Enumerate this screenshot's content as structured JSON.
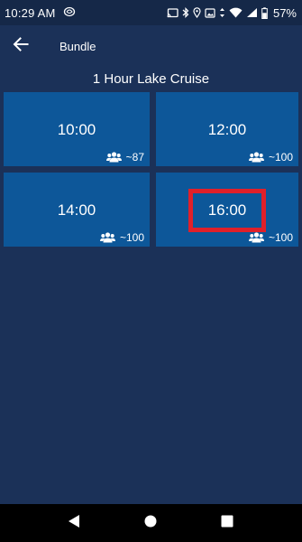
{
  "status_bar": {
    "time": "10:29 AM",
    "battery": "57%",
    "icons": [
      "app-notification-icon",
      "cast-icon",
      "bluetooth-icon",
      "location-icon",
      "screenshot-icon",
      "data-arrows-icon",
      "wifi-icon",
      "signal-icon",
      "battery-icon"
    ]
  },
  "app_bar": {
    "title": "Bundle",
    "back_icon": "arrow-left-icon"
  },
  "page": {
    "title": "1 Hour Lake Cruise"
  },
  "slots": [
    {
      "time": "10:00",
      "capacity": "~87",
      "icon": "people-icon"
    },
    {
      "time": "12:00",
      "capacity": "~100",
      "icon": "people-icon"
    },
    {
      "time": "14:00",
      "capacity": "~100",
      "icon": "people-icon"
    },
    {
      "time": "16:00",
      "capacity": "~100",
      "icon": "people-icon",
      "highlighted": true
    }
  ],
  "nav_bar": {
    "buttons": [
      "back-triangle-icon",
      "home-circle-icon",
      "recents-square-icon"
    ]
  },
  "colors": {
    "background": "#1b3158",
    "status_bar": "#152848",
    "card": "#0d5799",
    "highlight": "#e0202a",
    "nav_bar": "#000000"
  }
}
